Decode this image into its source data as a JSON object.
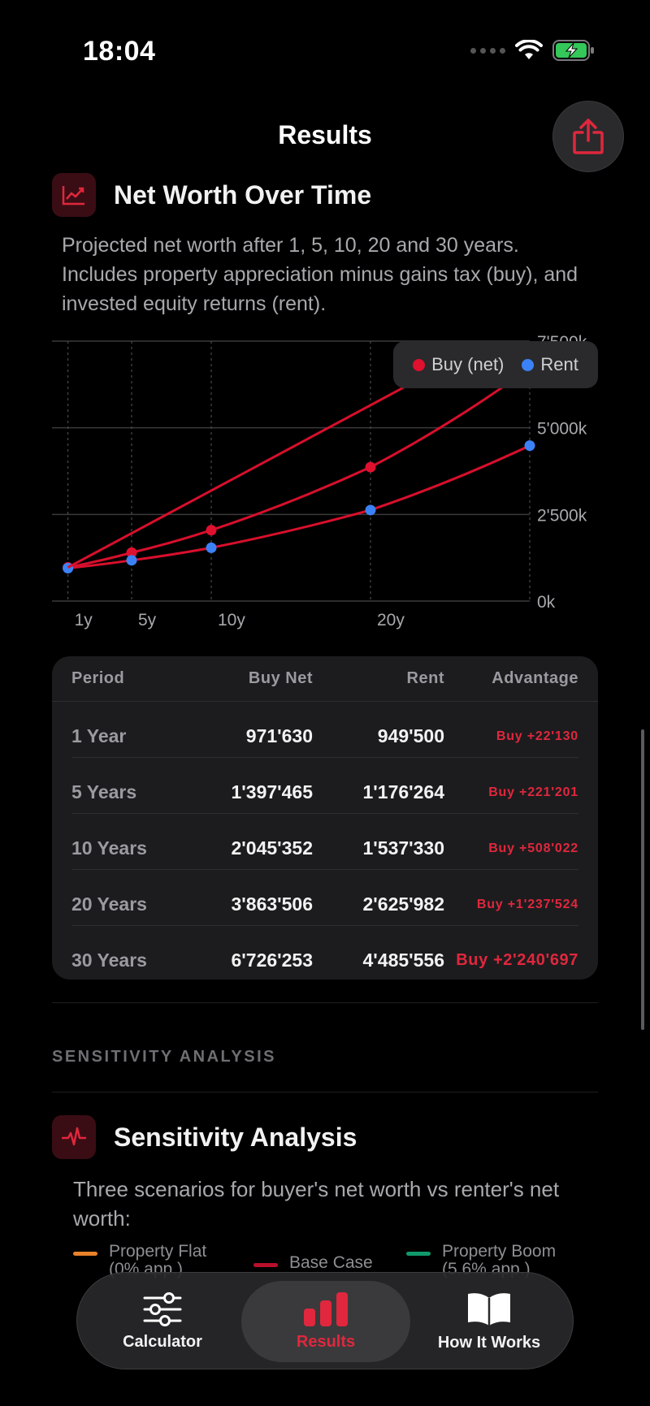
{
  "status_bar": {
    "time": "18:04"
  },
  "nav": {
    "title": "Results",
    "share_icon": "share-icon"
  },
  "net_worth": {
    "title": "Net Worth Over Time",
    "icon": "line-chart-icon",
    "description": "Projected net worth after 1, 5, 10, 20 and 30 years. Includes property appreciation minus gains tax (buy), and invested equity returns (rent)."
  },
  "chart_data": {
    "type": "line",
    "x": [
      1,
      5,
      10,
      20,
      30
    ],
    "xticks": [
      "1y",
      "5y",
      "10y",
      "20y"
    ],
    "yticks": [
      "0k",
      "2'500k",
      "5'000k",
      "7'500k"
    ],
    "ylim": [
      0,
      7500000
    ],
    "xlim": [
      0,
      30
    ],
    "legend_placement": "top-right",
    "series": [
      {
        "name": "Buy (net)",
        "color": "#e0102f",
        "values": [
          971630,
          1397465,
          2045352,
          3863506,
          6726253
        ]
      },
      {
        "name": "Rent",
        "color": "#3b82f6",
        "values": [
          949500,
          1176264,
          1537330,
          2625982,
          4485556
        ]
      }
    ]
  },
  "table": {
    "headers": {
      "period": "Period",
      "buy": "Buy Net",
      "rent": "Rent",
      "advantage": "Advantage"
    },
    "rows": [
      {
        "period": "1 Year",
        "buy": "971'630",
        "rent": "949'500",
        "advantage": "Buy +22'130"
      },
      {
        "period": "5 Years",
        "buy": "1'397'465",
        "rent": "1'176'264",
        "advantage": "Buy +221'201"
      },
      {
        "period": "10 Years",
        "buy": "2'045'352",
        "rent": "1'537'330",
        "advantage": "Buy +508'022"
      },
      {
        "period": "20 Years",
        "buy": "3'863'506",
        "rent": "2'625'982",
        "advantage": "Buy +1'237'524"
      },
      {
        "period": "30 Years",
        "buy": "6'726'253",
        "rent": "4'485'556",
        "advantage": "Buy +2'240'697"
      }
    ]
  },
  "sensitivity": {
    "section_label": "SENSITIVITY ANALYSIS",
    "title": "Sensitivity Analysis",
    "icon": "pulse-icon",
    "description": "Three scenarios for buyer's net worth vs renter's net worth:",
    "legend": [
      {
        "label": "Property Flat",
        "sub": "(0% app.)",
        "color": "#e8822b"
      },
      {
        "label": "Base Case",
        "color": "#b8102a"
      },
      {
        "label": "Property Boom",
        "sub": "(5.6% app.)",
        "color": "#109a6a"
      }
    ]
  },
  "tabbar": {
    "tabs": [
      {
        "label": "Calculator",
        "icon": "sliders-icon"
      },
      {
        "label": "Results",
        "icon": "bar-chart-icon"
      },
      {
        "label": "How It Works",
        "icon": "book-icon"
      }
    ],
    "active": "Results",
    "accent": "#e0273d"
  }
}
